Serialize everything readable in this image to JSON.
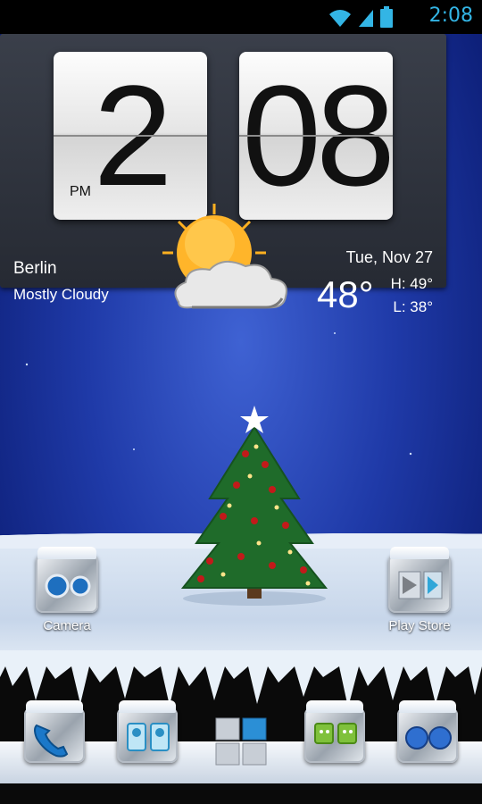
{
  "status_bar": {
    "time": "2:08",
    "icons": [
      "wifi-icon",
      "signal-icon",
      "battery-icon"
    ],
    "accent_color": "#33b5e5"
  },
  "clock_widget": {
    "hour": "2",
    "minutes": "08",
    "ampm": "PM",
    "city": "Berlin",
    "condition": "Mostly Cloudy",
    "date": "Tue, Nov 27",
    "temperature": "48°",
    "high": "H:  49°",
    "low": "L:  38°",
    "weather_icon": "partly-cloudy-icon"
  },
  "desktop_apps": [
    {
      "label": "Camera",
      "icon": "camera-icon"
    },
    {
      "label": "Play Store",
      "icon": "play-store-icon"
    }
  ],
  "dock": [
    {
      "icon": "phone-icon"
    },
    {
      "icon": "contacts-icon"
    },
    {
      "icon": "app-drawer-icon"
    },
    {
      "icon": "messaging-icon"
    },
    {
      "icon": "browser-icon"
    }
  ]
}
